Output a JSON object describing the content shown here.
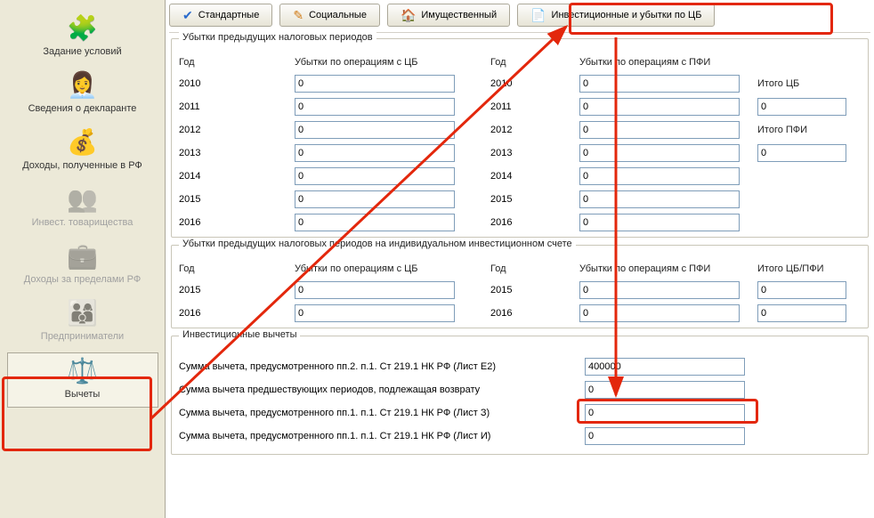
{
  "sidebar": {
    "items": [
      {
        "label": "Задание условий"
      },
      {
        "label": "Сведения о декларанте"
      },
      {
        "label": "Доходы, полученные в РФ"
      },
      {
        "label": "Инвест. товарищества"
      },
      {
        "label": "Доходы за пределами РФ"
      },
      {
        "label": "Предприниматели"
      },
      {
        "label": "Вычеты"
      }
    ]
  },
  "tabs": {
    "standard": "Стандартные",
    "social": "Социальные",
    "property": "Имущественный",
    "invest": "Инвестиционные и убытки по ЦБ"
  },
  "group1": {
    "title": "Убытки предыдущих налоговых периодов",
    "col_year": "Год",
    "col_cb": "Убытки по операциям с ЦБ",
    "col_year2": "Год",
    "col_pfi": "Убытки по операциям с ПФИ",
    "total_cb": "Итого ЦБ",
    "total_pfi": "Итого ПФИ",
    "years": [
      "2010",
      "2011",
      "2012",
      "2013",
      "2014",
      "2015",
      "2016"
    ],
    "cb_vals": [
      "0",
      "0",
      "0",
      "0",
      "0",
      "0",
      "0"
    ],
    "pfi_vals": [
      "0",
      "0",
      "0",
      "0",
      "0",
      "0",
      "0"
    ],
    "total_cb_val": "0",
    "total_pfi_val": "0"
  },
  "group2": {
    "title": "Убытки предыдущих налоговых периодов на индивидуальном инвестиционном счете",
    "col_year": "Год",
    "col_cb": "Убытки по операциям с ЦБ",
    "col_year2": "Год",
    "col_pfi": "Убытки по операциям с ПФИ",
    "col_total": "Итого ЦБ/ПФИ",
    "years": [
      "2015",
      "2016"
    ],
    "cb_vals": [
      "0",
      "0"
    ],
    "pfi_vals": [
      "0",
      "0"
    ],
    "total_vals": [
      "0",
      "0"
    ]
  },
  "group3": {
    "title": "Инвестиционные вычеты",
    "line1": "Сумма вычета, предусмотренного пп.2. п.1. Ст 219.1 НК РФ (Лист Е2)",
    "line1_val": "400000",
    "line2": "Сумма вычета предшествующих периодов, подлежащая возврату",
    "line2_val": "0",
    "line3": "Сумма вычета, предусмотренного пп.1. п.1. Ст 219.1 НК РФ (Лист З)",
    "line3_val": "0",
    "line4": "Сумма вычета, предусмотренного пп.1. п.1. Ст 219.1 НК РФ (Лист И)",
    "line4_val": "0"
  }
}
